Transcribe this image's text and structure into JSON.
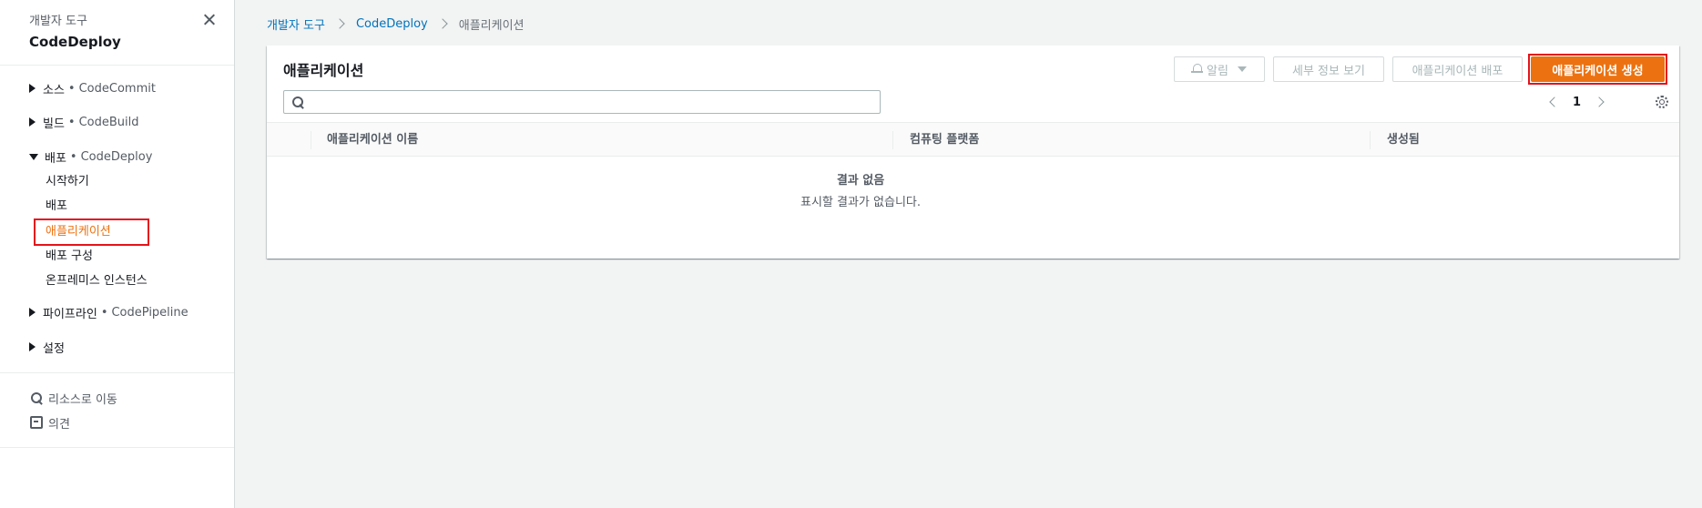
{
  "sidebar": {
    "subtitle": "개발자 도구",
    "title": "CodeDeploy",
    "sections": [
      {
        "label": "소스",
        "service": "CodeCommit"
      },
      {
        "label": "빌드",
        "service": "CodeBuild"
      },
      {
        "label": "배포",
        "service": "CodeDeploy"
      },
      {
        "label": "파이프라인",
        "service": "CodePipeline"
      },
      {
        "label": "설정"
      }
    ],
    "separator": "•",
    "deploy_links": [
      "시작하기",
      "배포",
      "애플리케이션",
      "배포 구성",
      "온프레미스 인스턴스"
    ],
    "active_link": "애플리케이션",
    "utils": {
      "go_to_resource": "리소스로 이동",
      "feedback": "의견"
    }
  },
  "breadcrumb": {
    "items": [
      "개발자 도구",
      "CodeDeploy",
      "애플리케이션"
    ]
  },
  "panel": {
    "title": "애플리케이션",
    "buttons": {
      "notify": "알림",
      "details": "세부 정보 보기",
      "deploy": "애플리케이션 배포",
      "create": "애플리케이션 생성"
    },
    "search": {
      "value": "",
      "placeholder": ""
    },
    "pagination": {
      "current_page": "1"
    },
    "columns": [
      "애플리케이션 이름",
      "컴퓨팅 플랫폼",
      "생성됨"
    ],
    "empty": {
      "title": "결과 없음",
      "description": "표시할 결과가 없습니다."
    }
  },
  "colors": {
    "accent": "#ec7211",
    "link": "#0073bb",
    "highlight": "#e4131b",
    "background": "#f2f3f3"
  }
}
